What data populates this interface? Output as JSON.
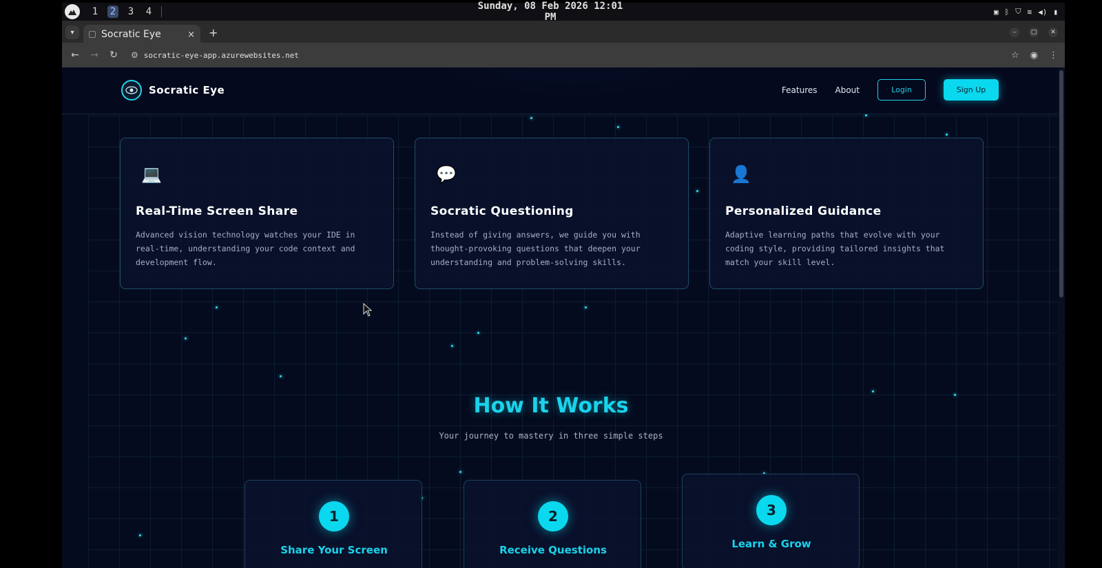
{
  "os": {
    "workspaces": [
      "1",
      "2",
      "3",
      "4"
    ],
    "active_workspace": "2",
    "clock": "Sunday, 08 Feb 2026 12:01 PM",
    "tray_icons": [
      "camera-icon",
      "bluetooth-icon",
      "shield-icon",
      "wifi-icon",
      "volume-icon",
      "battery-icon"
    ]
  },
  "browser": {
    "tab_title": "Socratic Eye",
    "tab_close": "×",
    "new_tab": "+",
    "url": "socratic-eye-app.azurewebsites.net"
  },
  "site": {
    "brand": "Socratic Eye",
    "nav": {
      "features": "Features",
      "about": "About",
      "login": "Login",
      "signup": "Sign Up"
    },
    "features": [
      {
        "icon": "💻",
        "title": "Real-Time Screen Share",
        "description": "Advanced vision technology watches your IDE in real-time, understanding your code context and development flow."
      },
      {
        "icon": "💬",
        "title": "Socratic Questioning",
        "description": "Instead of giving answers, we guide you with thought-provoking questions that deepen your understanding and problem-solving skills."
      },
      {
        "icon": "👤",
        "title": "Personalized Guidance",
        "description": "Adaptive learning paths that evolve with your coding style, providing tailored insights that match your skill level."
      }
    ],
    "how_it_works": {
      "title": "How It Works",
      "subtitle": "Your journey to mastery in three simple steps",
      "steps": [
        {
          "number": "1",
          "title": "Share Your Screen"
        },
        {
          "number": "2",
          "title": "Receive Questions"
        },
        {
          "number": "3",
          "title": "Learn & Grow"
        }
      ]
    }
  },
  "colors": {
    "accent": "#0ad8ef",
    "page_bg": "#050b1e",
    "card_border": "#2d82a0"
  }
}
